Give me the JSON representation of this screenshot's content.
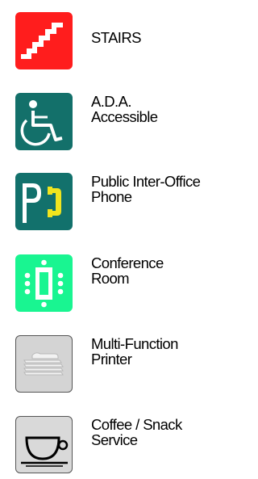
{
  "legend": {
    "items": [
      {
        "id": "stairs",
        "icon": "stairs-icon",
        "color": "#ff1d1d",
        "lines": [
          "STAIRS"
        ]
      },
      {
        "id": "ada",
        "icon": "wheelchair-icon",
        "color": "#13706a",
        "lines": [
          "A.D.A.",
          "Accessible"
        ]
      },
      {
        "id": "phone",
        "icon": "public-phone-icon",
        "color": "#12716c",
        "accent": "#f1e51e",
        "lines": [
          "Public Inter-Office",
          "Phone"
        ]
      },
      {
        "id": "conference",
        "icon": "conference-room-icon",
        "color": "#19f591",
        "lines": [
          "Conference",
          "Room"
        ]
      },
      {
        "id": "printer",
        "icon": "printer-icon",
        "color": "#d4d4d4",
        "lines": [
          "Multi-Function",
          "Printer"
        ]
      },
      {
        "id": "coffee",
        "icon": "coffee-cup-icon",
        "color": "#d9d9d9",
        "lines": [
          "Coffee / Snack",
          "Service"
        ]
      }
    ]
  }
}
